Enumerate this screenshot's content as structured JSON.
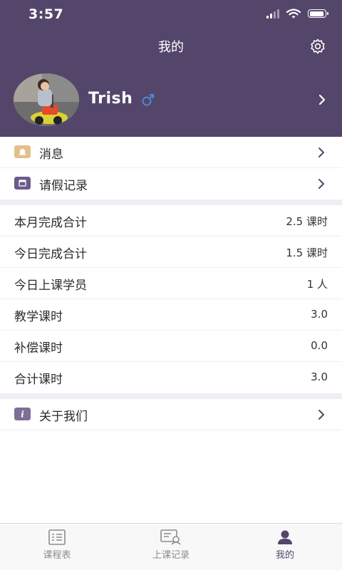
{
  "status_bar": {
    "time": "3:57"
  },
  "header": {
    "title": "我的"
  },
  "profile": {
    "name": "Trish",
    "gender_symbol": "♂"
  },
  "menu_top": [
    {
      "label": "消息",
      "icon": "bell-icon",
      "icon_color": "#e2c08c"
    },
    {
      "label": "请假记录",
      "icon": "calendar-icon",
      "icon_color": "#6b5b8a"
    }
  ],
  "stats": [
    {
      "label": "本月完成合计",
      "value": "2.5 课时"
    },
    {
      "label": "今日完成合计",
      "value": "1.5 课时"
    },
    {
      "label": "今日上课学员",
      "value": "1 人"
    },
    {
      "label": "教学课时",
      "value": "3.0"
    },
    {
      "label": "补偿课时",
      "value": "0.0"
    },
    {
      "label": "合计课时",
      "value": "3.0"
    }
  ],
  "menu_bottom": [
    {
      "label": "关于我们",
      "icon": "info-icon",
      "icon_color": "#7d6f96"
    }
  ],
  "tabbar": {
    "tabs": [
      {
        "label": "课程表",
        "icon": "schedule-icon",
        "active": false
      },
      {
        "label": "上课记录",
        "icon": "class-record-icon",
        "active": false
      },
      {
        "label": "我的",
        "icon": "profile-icon",
        "active": true
      }
    ]
  },
  "colors": {
    "header_bg": "#54466a",
    "accent": "#54466a",
    "gender_blue": "#4a8fe0"
  }
}
